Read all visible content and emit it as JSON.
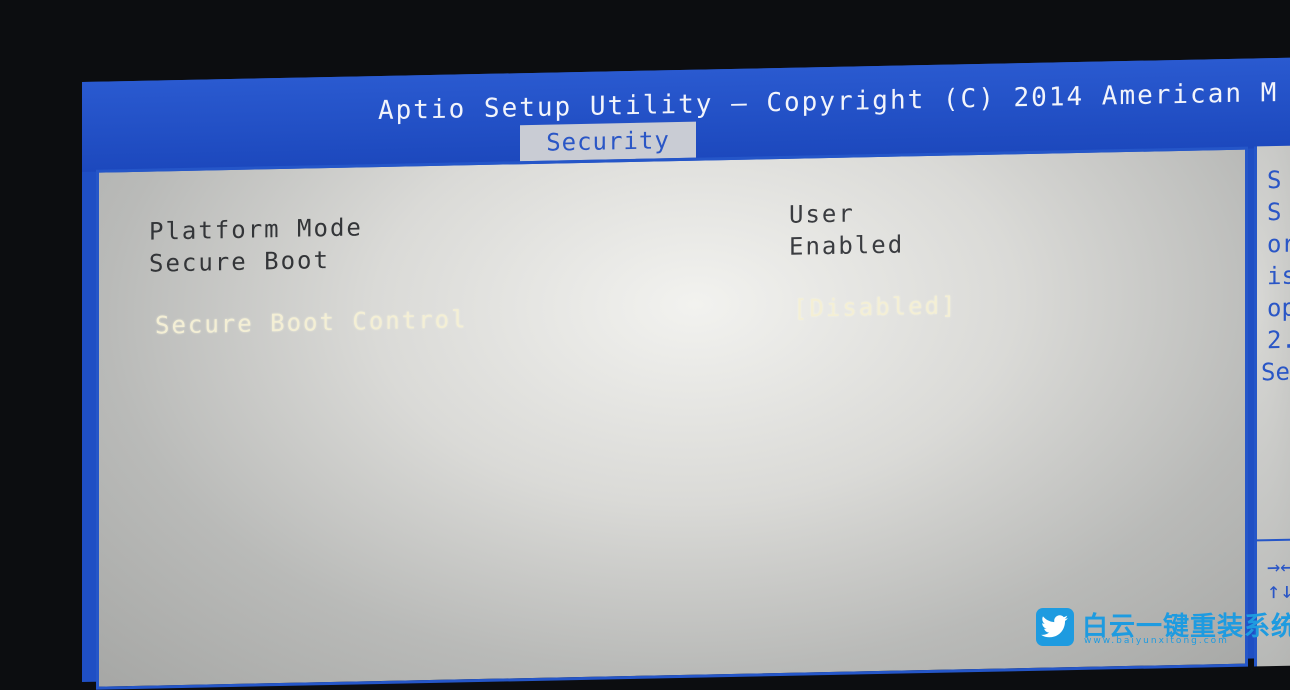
{
  "header": {
    "title": "Aptio Setup Utility – Copyright (C) 2014 American M",
    "active_tab": "Security"
  },
  "settings": [
    {
      "label": "Platform Mode",
      "value": "User",
      "selected": false
    },
    {
      "label": "Secure Boot",
      "value": "Enabled",
      "selected": false
    },
    {
      "label": "Secure Boot Control",
      "value": "[Disabled]",
      "selected": true
    }
  ],
  "help_panel": {
    "lines": [
      "S",
      "S",
      "or",
      "is",
      "op",
      "2.",
      "Se"
    ],
    "keys": [
      "→←:",
      "↑↓:"
    ]
  },
  "watermark": {
    "brand": "白云一键重装系统",
    "url": "www.baiyunxitong.com",
    "icon": "twitter-bird-icon"
  },
  "colors": {
    "bios_blue": "#1f4fc4",
    "panel_gray": "#c9ccd4",
    "selected_text": "#f4efd5"
  }
}
